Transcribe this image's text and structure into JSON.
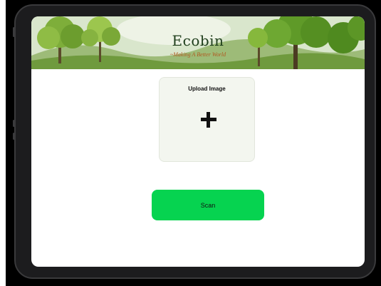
{
  "app": {
    "title": "Ecobin",
    "subtitle": "~Making A Better World"
  },
  "upload": {
    "label": "Upload Image",
    "icon": "plus-icon"
  },
  "actions": {
    "scan_label": "Scan"
  },
  "colors": {
    "scan_button": "#06d350",
    "upload_card": "#f3f6ef",
    "title_text": "#1e3d1b",
    "subtitle_text": "#b0581f"
  }
}
